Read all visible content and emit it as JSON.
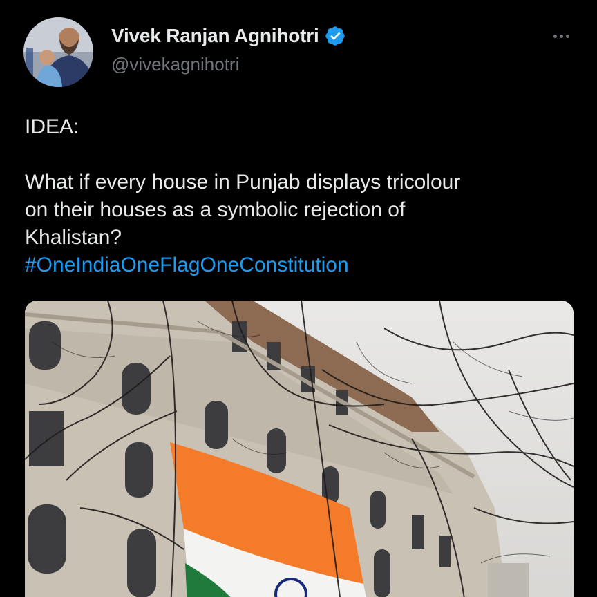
{
  "tweet": {
    "author": {
      "display_name": "Vivek Ranjan Agnihotri",
      "handle": "@vivekagnihotri",
      "verified": true,
      "verified_color": "#1d9bf0",
      "avatar_icon": "avatar-photo-icon"
    },
    "more_icon": "more-horizontal-icon",
    "text": {
      "line1": "IDEA:",
      "line2": "What if every house in Punjab displays tricolour",
      "line3": "on their houses as a symbolic rejection of",
      "line4": "Khalistan?",
      "hashtag": "#OneIndiaOneFlagOneConstitution"
    },
    "media": {
      "type": "photo",
      "icon": "photo-building-flag-icon"
    },
    "colors": {
      "background": "#000000",
      "text": "#e7e9ea",
      "secondary": "#71767b",
      "link": "#1d9bf0"
    }
  }
}
